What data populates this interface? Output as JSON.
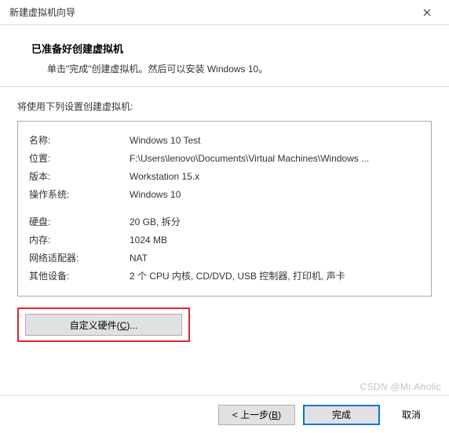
{
  "window": {
    "title": "新建虚拟机向导"
  },
  "header": {
    "title": "已准备好创建虚拟机",
    "subtitle": "单击\"完成\"创建虚拟机。然后可以安装 Windows 10。"
  },
  "intro": "将使用下列设置创建虚拟机:",
  "settings": {
    "name_label": "名称:",
    "name_value": "Windows 10 Test",
    "location_label": "位置:",
    "location_value": "F:\\Users\\lenovo\\Documents\\Virtual Machines\\Windows ...",
    "version_label": "版本:",
    "version_value": "Workstation 15.x",
    "os_label": "操作系统:",
    "os_value": "Windows 10",
    "disk_label": "硬盘:",
    "disk_value": "20 GB, 拆分",
    "memory_label": "内存:",
    "memory_value": "1024 MB",
    "network_label": "网络适配器:",
    "network_value": "NAT",
    "other_label": "其他设备:",
    "other_value": "2 个 CPU 内核, CD/DVD, USB 控制器, 打印机, 声卡"
  },
  "buttons": {
    "customize_prefix": "自定义硬件(",
    "customize_key": "C",
    "customize_suffix": ")...",
    "back_prefix": "< 上一步(",
    "back_key": "B",
    "back_suffix": ")",
    "finish": "完成",
    "cancel": "取消"
  },
  "watermark": "CSDN @Mr.Aholic"
}
